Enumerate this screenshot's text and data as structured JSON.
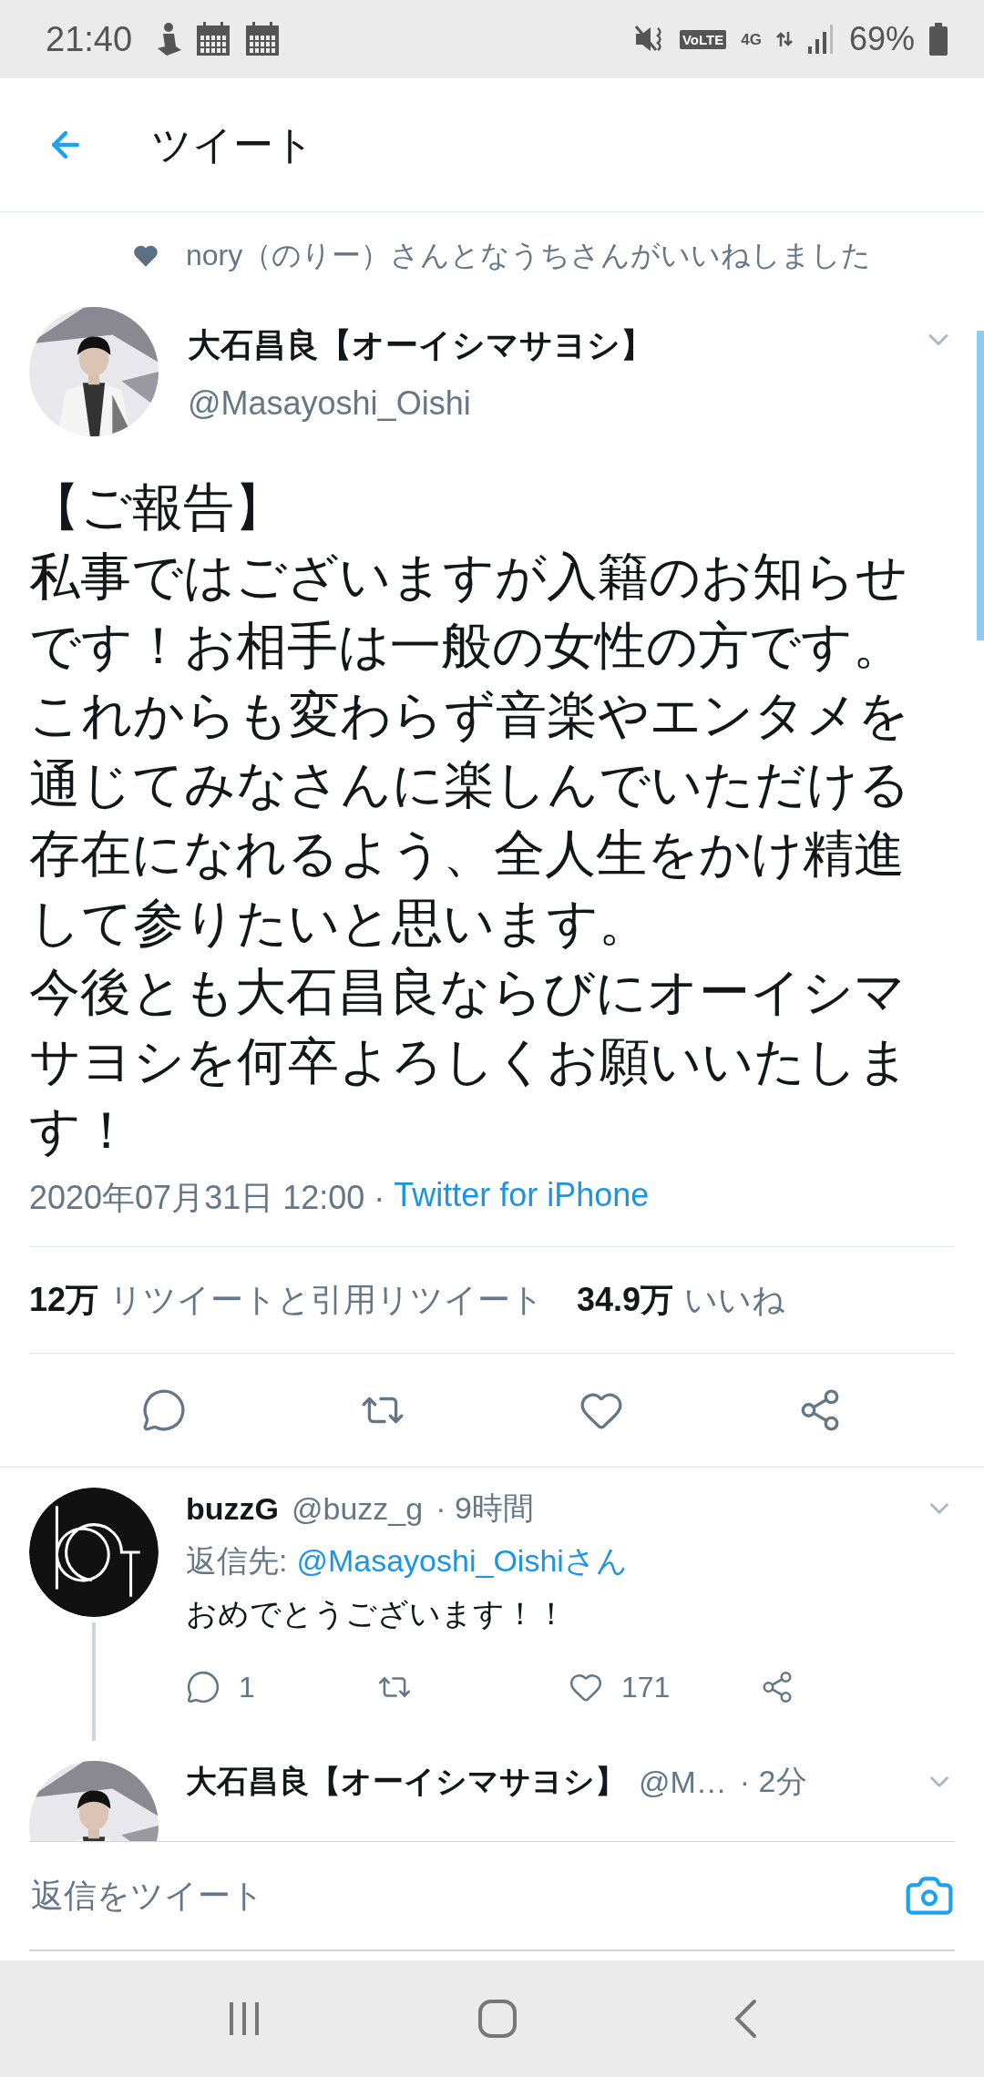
{
  "status_bar": {
    "time": "21:40",
    "volte": "VoLTE",
    "network": "4G",
    "battery": "69%"
  },
  "header": {
    "title": "ツイート"
  },
  "social_context": {
    "text": "nory（のりー）さんとなうちさんがいいねしました"
  },
  "tweet": {
    "name": "大石昌良【オーイシマサヨシ】",
    "handle": "@Masayoshi_Oishi",
    "paragraphs": [
      "【ご報告】",
      "私事ではございますが入籍のお知らせです！お相手は一般の女性の方です。これからも変わらず音楽やエンタメを通じてみなさんに楽しんでいただける存在になれるよう、全人生をかけ精進して参りたいと思います。",
      "今後とも大石昌良ならびにオーイシマサヨシを何卒よろしくお願いいたします！"
    ],
    "timestamp": "2020年07月31日 12:00 ·",
    "source": "Twitter for iPhone",
    "stats": [
      {
        "count": "12万",
        "label": "リツイートと引用リツイート"
      },
      {
        "count": "34.9万",
        "label": "いいね"
      }
    ],
    "actions": [
      {
        "kind": "reply"
      },
      {
        "kind": "retweet"
      },
      {
        "kind": "like"
      },
      {
        "kind": "share"
      }
    ]
  },
  "replies": [
    {
      "avatar": {
        "kind": "logo"
      },
      "name": "buzzG",
      "handle": "@buzz_g",
      "time": "· 9時間",
      "reply_to_label": "返信先:",
      "reply_to": "@Masayoshi_Oishiさん",
      "text": "おめでとうございます！！",
      "connected": true,
      "actions": [
        {
          "kind": "reply",
          "count": "1"
        },
        {
          "kind": "retweet"
        },
        {
          "kind": "like",
          "count": "171"
        },
        {
          "kind": "share"
        }
      ]
    },
    {
      "name": "大石昌良【オーイシマサヨシ】",
      "handle": "@M…",
      "time": "· 2分",
      "connected": false
    }
  ],
  "composer": {
    "placeholder": "返信をツイート"
  }
}
